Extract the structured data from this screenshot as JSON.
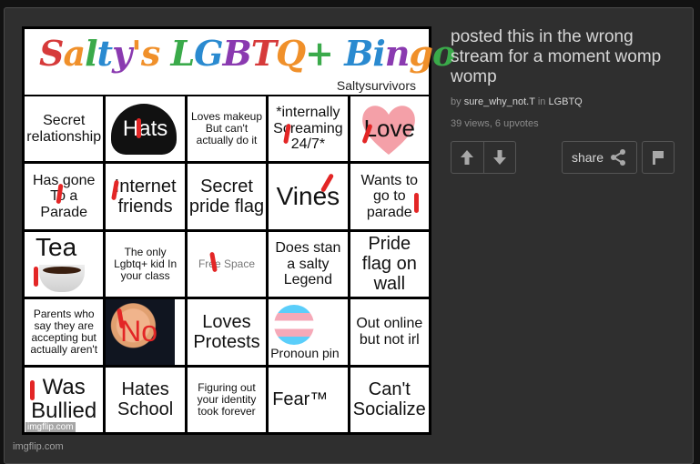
{
  "meme": {
    "title_letters": [
      {
        "ch": "S",
        "color": "#d63a3a"
      },
      {
        "ch": "a",
        "color": "#f0902a"
      },
      {
        "ch": "l",
        "color": "#3aaa4a"
      },
      {
        "ch": "t",
        "color": "#2a8ad0"
      },
      {
        "ch": "y",
        "color": "#8a3ab0"
      },
      {
        "ch": "'",
        "color": "#f0902a"
      },
      {
        "ch": "s",
        "color": "#f0902a"
      },
      {
        "ch": " ",
        "color": "#000"
      },
      {
        "ch": "L",
        "color": "#3aaa4a"
      },
      {
        "ch": "G",
        "color": "#2a8ad0"
      },
      {
        "ch": "B",
        "color": "#8a3ab0"
      },
      {
        "ch": "T",
        "color": "#d63a3a"
      },
      {
        "ch": "Q",
        "color": "#f0902a"
      },
      {
        "ch": "+",
        "color": "#3aaa4a"
      },
      {
        "ch": " ",
        "color": "#000"
      },
      {
        "ch": "B",
        "color": "#2a8ad0"
      },
      {
        "ch": "i",
        "color": "#2a8ad0"
      },
      {
        "ch": "n",
        "color": "#8a3ab0"
      },
      {
        "ch": "g",
        "color": "#f0902a"
      },
      {
        "ch": "o",
        "color": "#3aaa4a"
      }
    ],
    "subtitle": "Saltysurvivors",
    "cells": [
      "Secret relationship",
      "Hats",
      "Loves makeup But can't actually do it",
      "*internally Screaming 24/7*",
      "Love",
      "Has gone To a Parade",
      "Internet friends",
      "Secret pride flag",
      "Vines",
      "Wants to go to parade",
      "Tea",
      "The only Lgbtq+ kid In your class",
      "Free Space",
      "Does stan a salty Legend",
      "Pride flag on wall",
      "Parents who say they are accepting but actually aren't",
      "No",
      "Loves Protests",
      "Pronoun pin",
      "Out online but not irl",
      "Was Bullied",
      "Hates School",
      "Figuring out your identity took forever",
      "Fear™",
      "Can't Socialize"
    ],
    "watermark": "imgflip.com"
  },
  "credit": "imgflip.com",
  "post": {
    "title": "posted this in the wrong stream for a moment womp womp",
    "by_label": "by",
    "author": "sure_why_not.T",
    "in_label": "in",
    "stream": "LGBTQ",
    "stats": "39 views, 6 upvotes"
  },
  "actions": {
    "upvote_icon": "arrow-up-icon",
    "downvote_icon": "arrow-down-icon",
    "share_label": "share",
    "share_icon": "share-icon",
    "flag_icon": "flag-icon"
  },
  "colors": {
    "mark": "#e32626",
    "panel": "#2f2f2f",
    "text": "#d6d6d6"
  }
}
